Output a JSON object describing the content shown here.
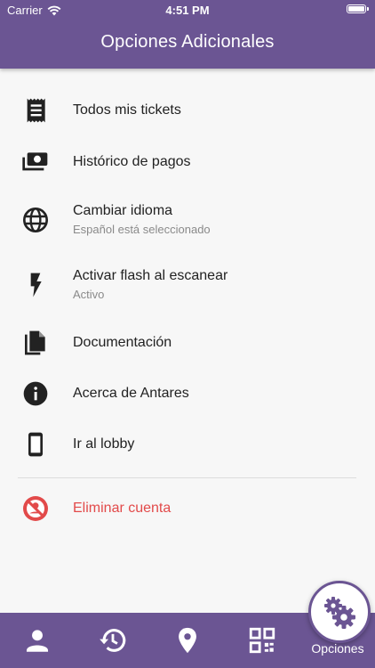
{
  "status_bar": {
    "carrier": "Carrier",
    "time": "4:51 PM"
  },
  "header": {
    "title": "Opciones Adicionales"
  },
  "menu": {
    "items": [
      {
        "label": "Todos mis tickets",
        "icon": "receipt-icon"
      },
      {
        "label": "Histórico de pagos",
        "icon": "payments-icon"
      },
      {
        "label": "Cambiar idioma",
        "sublabel": "Español está seleccionado",
        "icon": "globe-icon"
      },
      {
        "label": "Activar flash al escanear",
        "sublabel": "Activo",
        "icon": "flash-icon"
      },
      {
        "label": "Documentación",
        "icon": "documents-icon"
      },
      {
        "label": "Acerca de Antares",
        "icon": "info-icon"
      },
      {
        "label": "Ir al lobby",
        "icon": "phone-icon"
      },
      {
        "label": "Eliminar cuenta",
        "icon": "no-account-icon"
      }
    ]
  },
  "bottom_nav": {
    "items": [
      {
        "icon": "person-icon"
      },
      {
        "icon": "history-icon"
      },
      {
        "icon": "location-pin-icon"
      },
      {
        "icon": "qr-code-icon"
      }
    ],
    "active": {
      "label": "Opciones",
      "icon": "gears-icon"
    }
  },
  "colors": {
    "primary": "#6b5593",
    "danger": "#e24a4a",
    "text": "#222222",
    "subtext": "#8a8a8a"
  }
}
